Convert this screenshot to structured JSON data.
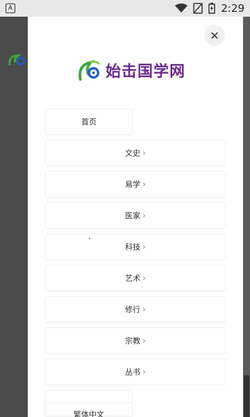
{
  "status_bar": {
    "left_icon_label": "A",
    "time": "2:29"
  },
  "drawer": {
    "brand_name": "始击国学网",
    "close_label": "✕",
    "menu": [
      {
        "label": "首页",
        "has_chevron": false
      },
      {
        "label": "文史",
        "has_chevron": true
      },
      {
        "label": "易学",
        "has_chevron": true
      },
      {
        "label": "医家",
        "has_chevron": true
      },
      {
        "label": "科技",
        "has_chevron": true
      },
      {
        "label": "艺术",
        "has_chevron": true
      },
      {
        "label": "修行",
        "has_chevron": true
      },
      {
        "label": "宗教",
        "has_chevron": true
      },
      {
        "label": "丛书",
        "has_chevron": true
      }
    ],
    "chevron": "›",
    "language_label": "繁体中文"
  },
  "colors": {
    "brand_purple": "#6b2a8c",
    "logo_green": "#3aa83a",
    "logo_blue": "#1e5bd6"
  }
}
